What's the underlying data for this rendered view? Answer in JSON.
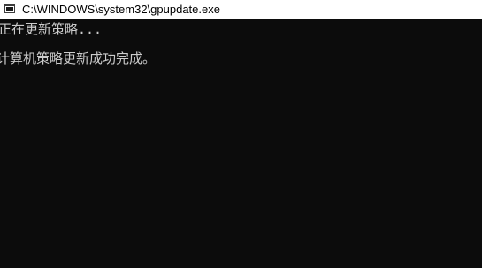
{
  "window": {
    "title": "C:\\WINDOWS\\system32\\gpupdate.exe",
    "icon": "console-window-icon"
  },
  "console": {
    "lines": [
      "正在更新策略...",
      "计算机策略更新成功完成。"
    ]
  },
  "colors": {
    "titlebar_bg": "#ffffff",
    "console_bg": "#0c0c0c",
    "console_text": "#cccccc"
  }
}
